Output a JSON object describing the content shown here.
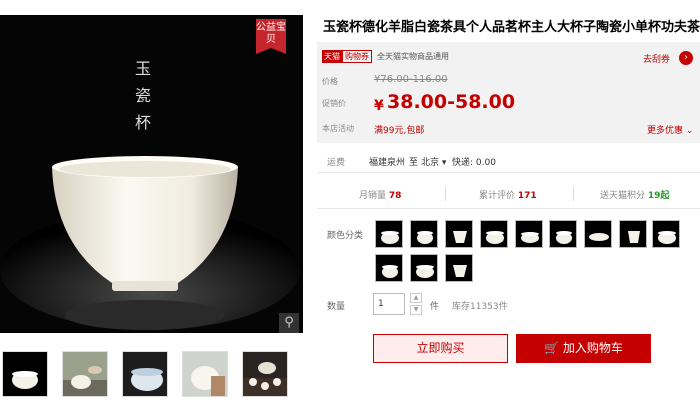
{
  "product": {
    "title": "玉瓷杯德化羊脂白瓷茶具个人品茗杯主人大杯子陶瓷小单杯功夫茶杯",
    "image_text": "玉瓷杯",
    "badge": "公益宝贝",
    "zoom_icon": "magnifier-icon"
  },
  "thumbnails": [
    "thumb-1",
    "thumb-2",
    "thumb-3",
    "thumb-4",
    "thumb-5"
  ],
  "promo": {
    "tmall_tag": "天猫",
    "coupon_tag": "购物券",
    "text": "全天猫实物商品通用",
    "get_coupon": "去刮券",
    "get_coupon_icon": "›"
  },
  "price": {
    "original_label": "价格",
    "original": "¥76.00-116.00",
    "promo_label": "促销价",
    "currency": "¥",
    "current": "38.00-58.00",
    "store_label": "本店活动",
    "store_promo": "满99元,包邮",
    "more": "更多优惠"
  },
  "delivery": {
    "label": "运费",
    "from": "福建泉州",
    "to_word": "至",
    "to": "北京",
    "express": "快递: 0.00"
  },
  "stats": {
    "monthly_label": "月销量",
    "monthly": "78",
    "reviews_label": "累计评价",
    "reviews": "171",
    "points_label": "送天猫积分",
    "points": "19起"
  },
  "options": {
    "color_label": "颜色分类",
    "qty_label": "数量",
    "qty_value": "1",
    "qty_unit": "件",
    "stock": "库存11353件"
  },
  "buttons": {
    "buy_now": "立即购买",
    "add_to_cart": "加入购物车",
    "cart_icon": "shopping-cart-icon"
  },
  "colors": {
    "accent": "#c40000",
    "price_bg": "#f2f2f2"
  }
}
